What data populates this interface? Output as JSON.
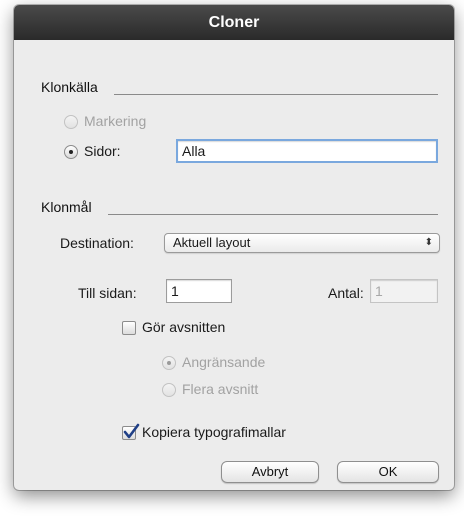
{
  "window": {
    "title": "Cloner"
  },
  "source": {
    "title": "Klonkälla",
    "options": [
      {
        "label": "Markering",
        "selected": false,
        "enabled": false
      },
      {
        "label": "Sidor:",
        "selected": true,
        "enabled": true
      }
    ],
    "pages_value": "Alla"
  },
  "target": {
    "title": "Klonmål",
    "destination_label": "Destination:",
    "destination_value": "Aktuell layout",
    "to_page_label": "Till sidan:",
    "to_page_value": "1",
    "count_label": "Antal:",
    "count_value": "1",
    "make_sections_label": "Gör avsnitten",
    "make_sections_checked": false,
    "section_options": [
      {
        "label": "Angränsande",
        "selected": true,
        "enabled": false
      },
      {
        "label": "Flera avsnitt",
        "selected": false,
        "enabled": false
      }
    ],
    "copy_styles_label": "Kopiera typografimallar",
    "copy_styles_checked": true
  },
  "buttons": {
    "cancel": "Avbryt",
    "ok": "OK"
  },
  "colors": {
    "titlebar": "#333333",
    "window_bg": "#ececec",
    "focus_ring": "#7aa8de",
    "check": "#1f3f86"
  }
}
